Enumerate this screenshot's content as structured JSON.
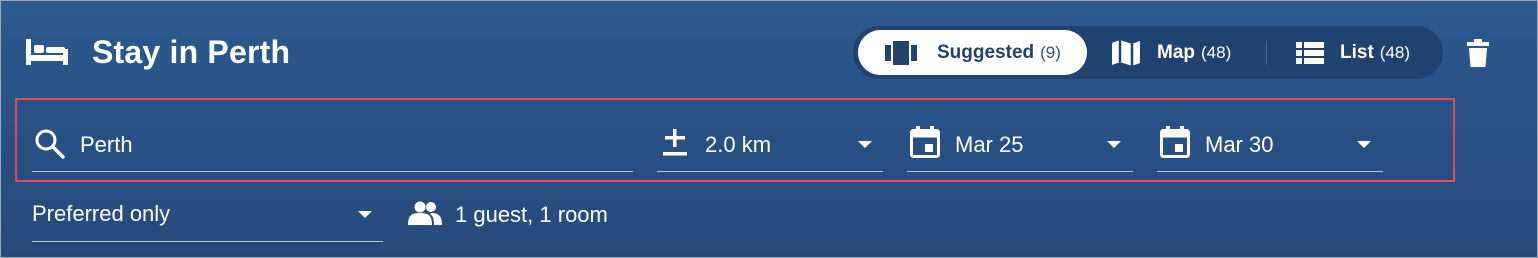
{
  "header": {
    "title": "Stay in Perth",
    "title_icon": "bed-icon",
    "views": [
      {
        "label": "Suggested",
        "count": "(9)",
        "icon": "carousel-icon",
        "active": true
      },
      {
        "label": "Map",
        "count": "(48)",
        "icon": "map-icon",
        "active": false
      },
      {
        "label": "List",
        "count": "(48)",
        "icon": "list-icon",
        "active": false
      }
    ],
    "delete_icon": "trash-icon"
  },
  "search": {
    "location_value": "Perth",
    "location_icon": "search-icon",
    "radius_value": "2.0 km",
    "radius_icon": "plus-minus-icon",
    "checkin_value": "Mar 25",
    "checkin_icon": "calendar-icon",
    "checkout_value": "Mar 30",
    "checkout_icon": "calendar-icon"
  },
  "filters": {
    "preference_value": "Preferred only",
    "guests_text": "1 guest, 1 room",
    "guests_icon": "people-icon"
  },
  "colors": {
    "background": "#2a5488",
    "highlight_border": "#e04a57",
    "toggle_track": "#204270",
    "active_text": "#23436b"
  }
}
